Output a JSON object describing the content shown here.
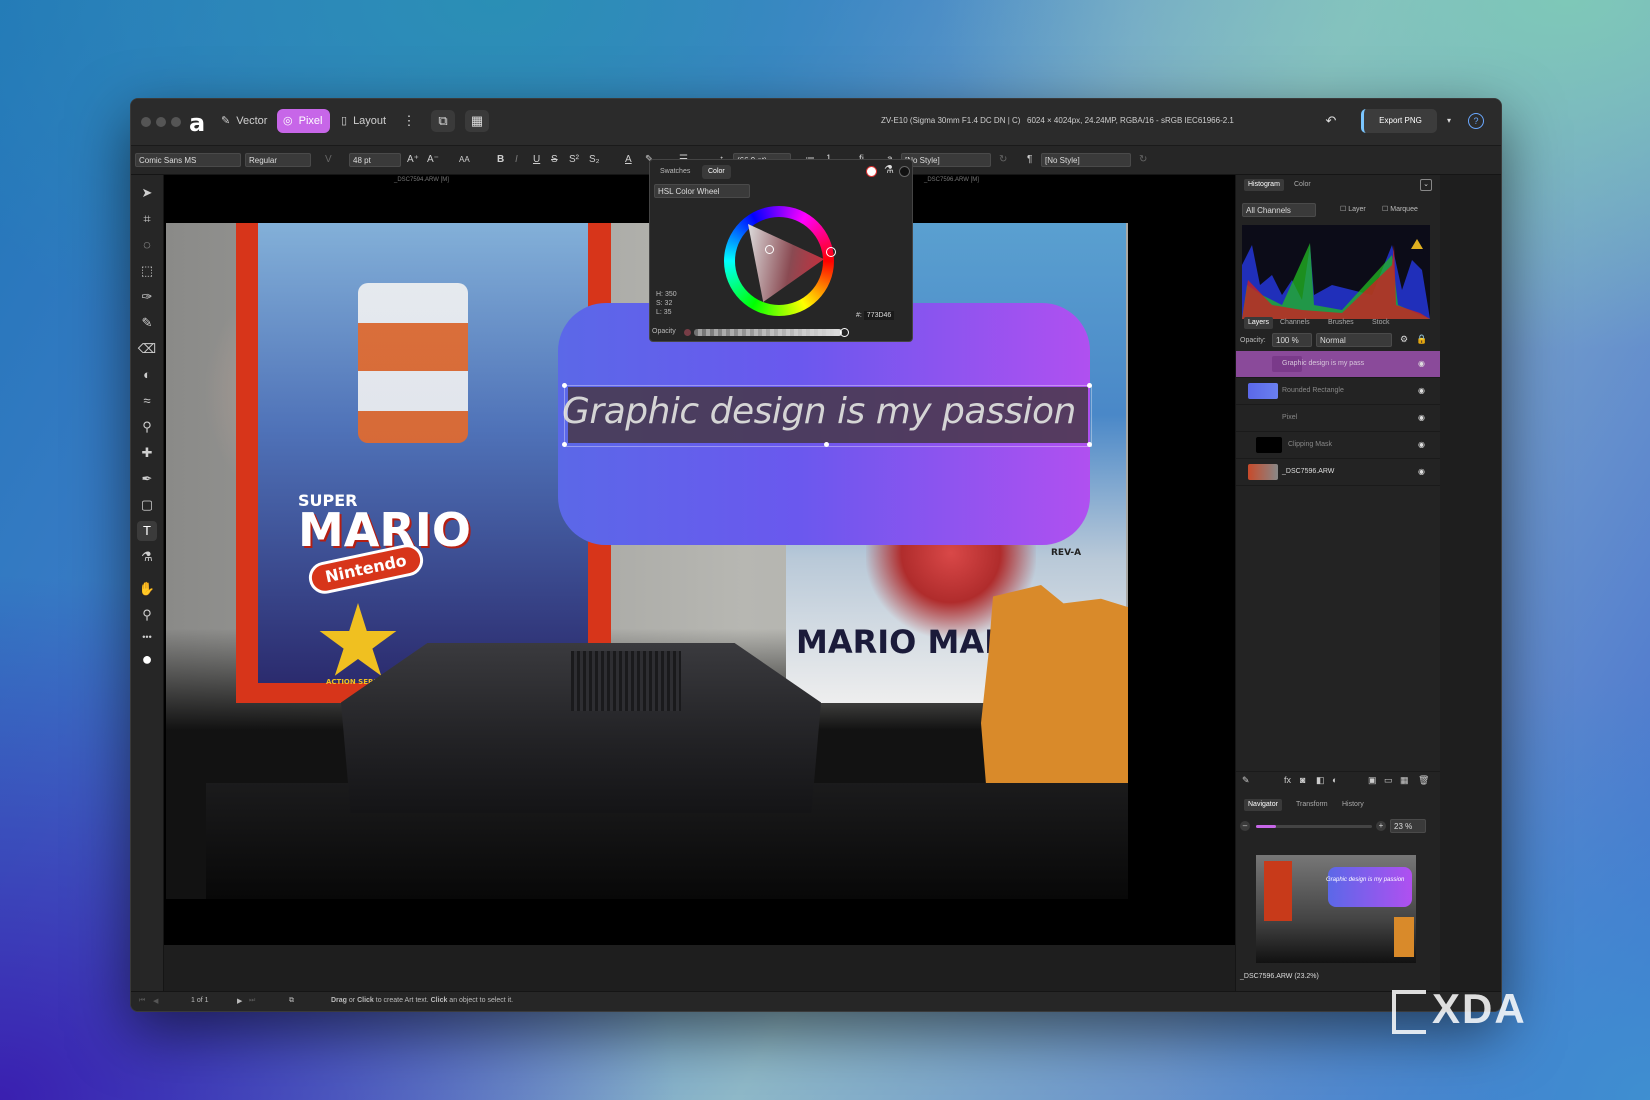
{
  "app": {
    "personas": [
      "Vector",
      "Pixel",
      "Layout"
    ],
    "active_persona": "Pixel",
    "camera_info": "ZV-E10 (Sigma 30mm F1.4 DC DN | C)",
    "doc_info": "6024 × 4024px, 24.24MP, RGBA/16 - sRGB IEC61966-2.1",
    "export_label": "Export PNG"
  },
  "context_toolbar": {
    "font_family": "Comic Sans MS",
    "font_style": "Regular",
    "font_size": "48 pt",
    "leading": "(66.9 pt)",
    "char_style": "[No Style]",
    "para_style": "[No Style]"
  },
  "documents": {
    "tab_left": "_DSC7594.ARW [M]",
    "tab_right": "_DSC7596.ARW [M]"
  },
  "canvas": {
    "art_text": "Graphic design is my passion",
    "poster1_sub": "SUPER",
    "poster1_title": "MARIO",
    "poster1_badge": "Nintendo",
    "poster1_series": "ACTION SERIES",
    "poster2_title": "MARIO MADNE",
    "poster2_rev": "REV-A"
  },
  "color_panel": {
    "tabs": [
      "Swatches",
      "Color"
    ],
    "active_tab": "Color",
    "mode": "HSL Color Wheel",
    "h": "H: 350",
    "s": "S: 32",
    "l": "L: 35",
    "hex_label": "#:",
    "hex_value": "773D46",
    "opacity_label": "Opacity"
  },
  "histogram_panel": {
    "tabs": [
      "Histogram",
      "Color"
    ],
    "channel": "All Channels",
    "layer_label": "Layer",
    "marquee_label": "Marquee"
  },
  "layers_panel": {
    "tabs": [
      "Layers",
      "Channels",
      "Brushes",
      "Stock"
    ],
    "opacity_label": "Opacity:",
    "opacity_value": "100 %",
    "blend_mode": "Normal",
    "layers": [
      {
        "name": "Graphic design is my pass"
      },
      {
        "name": "Rounded Rectangle"
      },
      {
        "name": "Pixel"
      },
      {
        "name": "Clipping Mask"
      },
      {
        "name": "_DSC7596.ARW"
      }
    ]
  },
  "navigator_panel": {
    "tabs": [
      "Navigator",
      "Transform",
      "History"
    ],
    "zoom": "23 %",
    "doc_label": "_DSC7596.ARW (23.2%)"
  },
  "status": {
    "page": "1 of 1",
    "hint_part1": "Drag",
    "hint_part2": " or ",
    "hint_part3": "Click",
    "hint_part4": " to create Art text. ",
    "hint_part5": "Click",
    "hint_part6": " an object to select it."
  },
  "watermark": "XDA",
  "colors": {
    "accent_pixel": "#c766e8",
    "rect_start": "#5b68e8",
    "rect_end": "#b050f0",
    "selected_layer": "#8a4a9a"
  }
}
